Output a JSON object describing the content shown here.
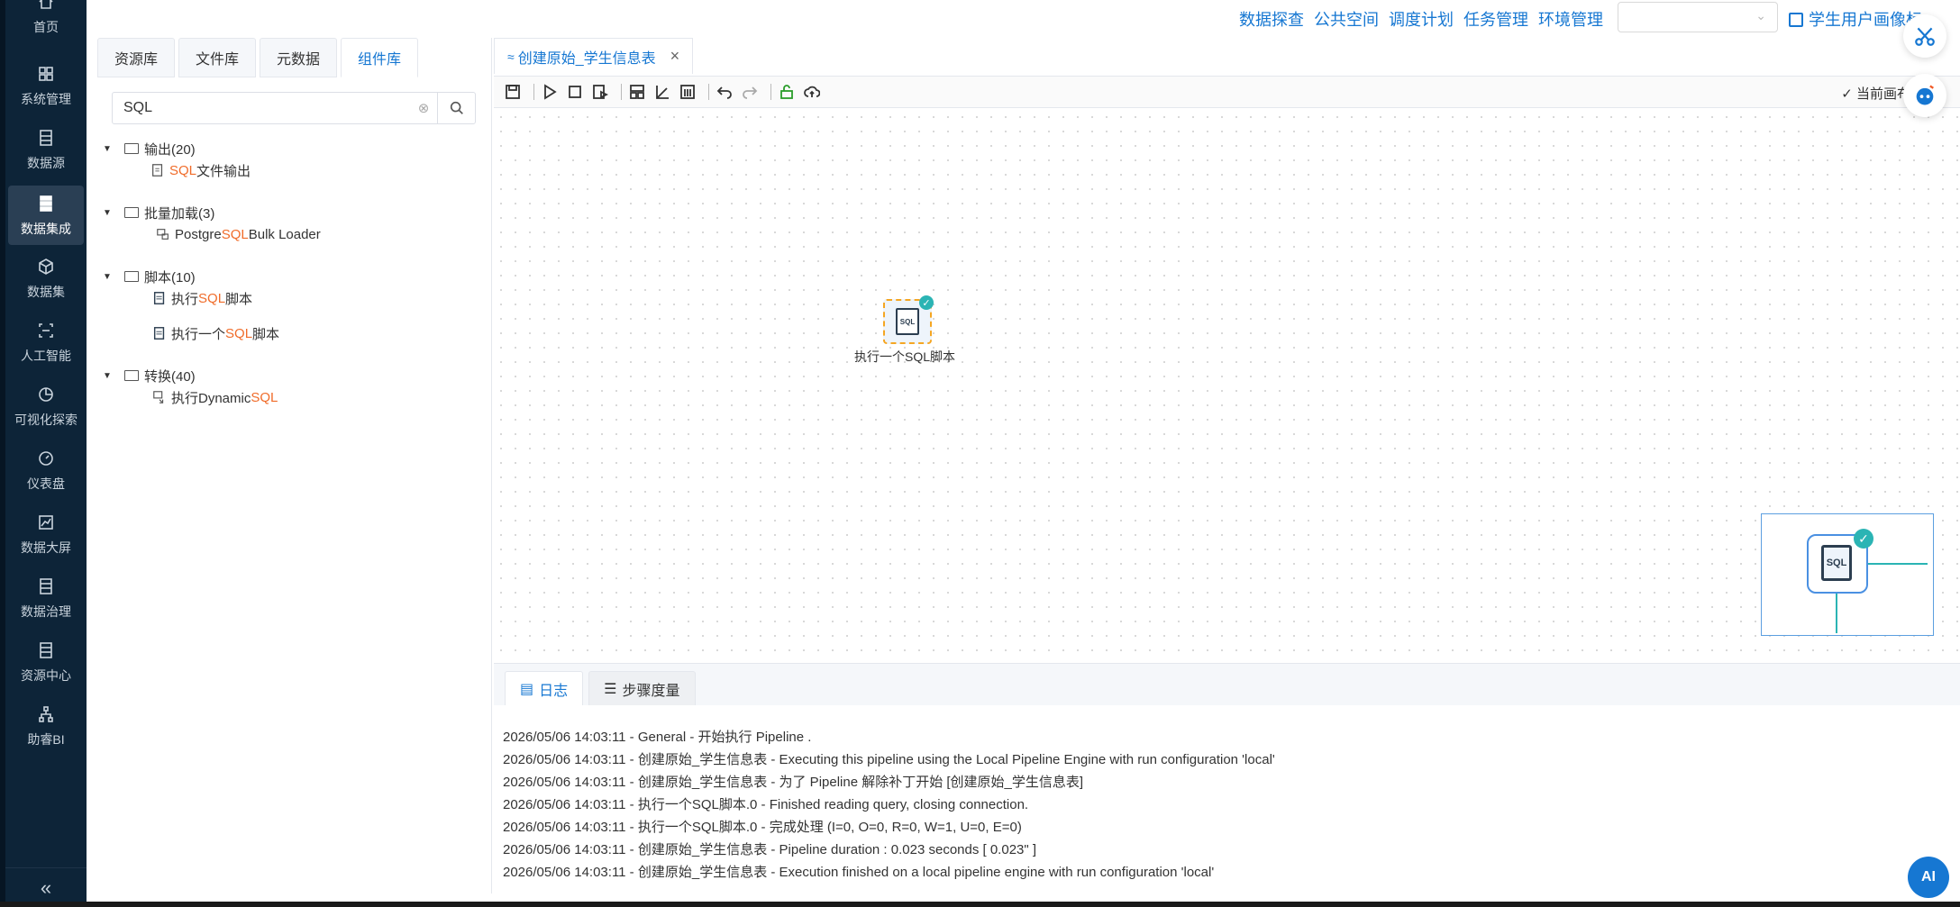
{
  "nav": {
    "items": [
      {
        "label": "首页",
        "icon": "home-icon"
      },
      {
        "label": "系统管理",
        "icon": "grid-icon"
      },
      {
        "label": "数据源",
        "icon": "database-icon"
      },
      {
        "label": "数据集成",
        "icon": "integration-icon"
      },
      {
        "label": "数据集",
        "icon": "cube-icon"
      },
      {
        "label": "人工智能",
        "icon": "ai-scan-icon"
      },
      {
        "label": "可视化探索",
        "icon": "pie-icon"
      },
      {
        "label": "仪表盘",
        "icon": "gauge-icon"
      },
      {
        "label": "数据大屏",
        "icon": "chart-line-icon"
      },
      {
        "label": "数据治理",
        "icon": "list-icon"
      },
      {
        "label": "资源中心",
        "icon": "resource-icon"
      },
      {
        "label": "助睿BI",
        "icon": "org-icon"
      }
    ],
    "collapse_label": "«"
  },
  "topbar": {
    "links": [
      "数据探查",
      "公共空间",
      "调度计划",
      "任务管理",
      "环境管理"
    ],
    "select_value": "",
    "profile_label": "学生用户画像标"
  },
  "left_panel": {
    "tabs": [
      "资源库",
      "文件库",
      "元数据",
      "组件库"
    ],
    "search_value": "SQL",
    "tree": {
      "groups": [
        {
          "name": "输出(20)",
          "items": [
            {
              "pre": "",
              "hl": "SQL",
              "post": " 文件输出"
            }
          ]
        },
        {
          "name": "批量加载(3)",
          "items": [
            {
              "pre": "Postgre ",
              "hl": "SQL",
              "post": " Bulk Loader"
            }
          ]
        },
        {
          "name": "脚本(10)",
          "items": [
            {
              "pre": "执行 ",
              "hl": "SQL",
              "post": " 脚本"
            },
            {
              "pre": "执行一个 ",
              "hl": "SQL",
              "post": " 脚本"
            }
          ]
        },
        {
          "name": "转换(40)",
          "items": [
            {
              "pre": "执行Dynamic ",
              "hl": "SQL",
              "post": ""
            }
          ]
        }
      ]
    }
  },
  "editor": {
    "tab_title": "创建原始_学生信息表",
    "close_glyph": "×",
    "canvas_status": "当前画布已",
    "node": {
      "label": "执行一个SQL脚本",
      "doc_text": "SQL"
    }
  },
  "log_panel": {
    "tabs": [
      "日志",
      "步骤度量"
    ],
    "lines": [
      "2026/05/06 14:03:11 - General - 开始执行 Pipeline .",
      "2026/05/06 14:03:11 - 创建原始_学生信息表 - Executing this pipeline using the Local Pipeline Engine with run configuration 'local'",
      "2026/05/06 14:03:11 - 创建原始_学生信息表 - 为了 Pipeline 解除补丁开始 [创建原始_学生信息表]",
      "2026/05/06 14:03:11 - 执行一个SQL脚本.0 - Finished reading query, closing connection.",
      "2026/05/06 14:03:11 - 执行一个SQL脚本.0 - 完成处理 (I=0, O=0, R=0, W=1, U=0, E=0)",
      "2026/05/06 14:03:11 - 创建原始_学生信息表 - Pipeline duration : 0.023 seconds [  0.023\" ]",
      "2026/05/06 14:03:11 - 创建原始_学生信息表 - Execution finished on a local pipeline engine with run configuration 'local'"
    ]
  },
  "ai_label": "AI",
  "colors": {
    "accent": "#1677d2",
    "highlight": "#f06c2a",
    "nav_bg": "#0d2438",
    "success": "#2bb4b4"
  }
}
